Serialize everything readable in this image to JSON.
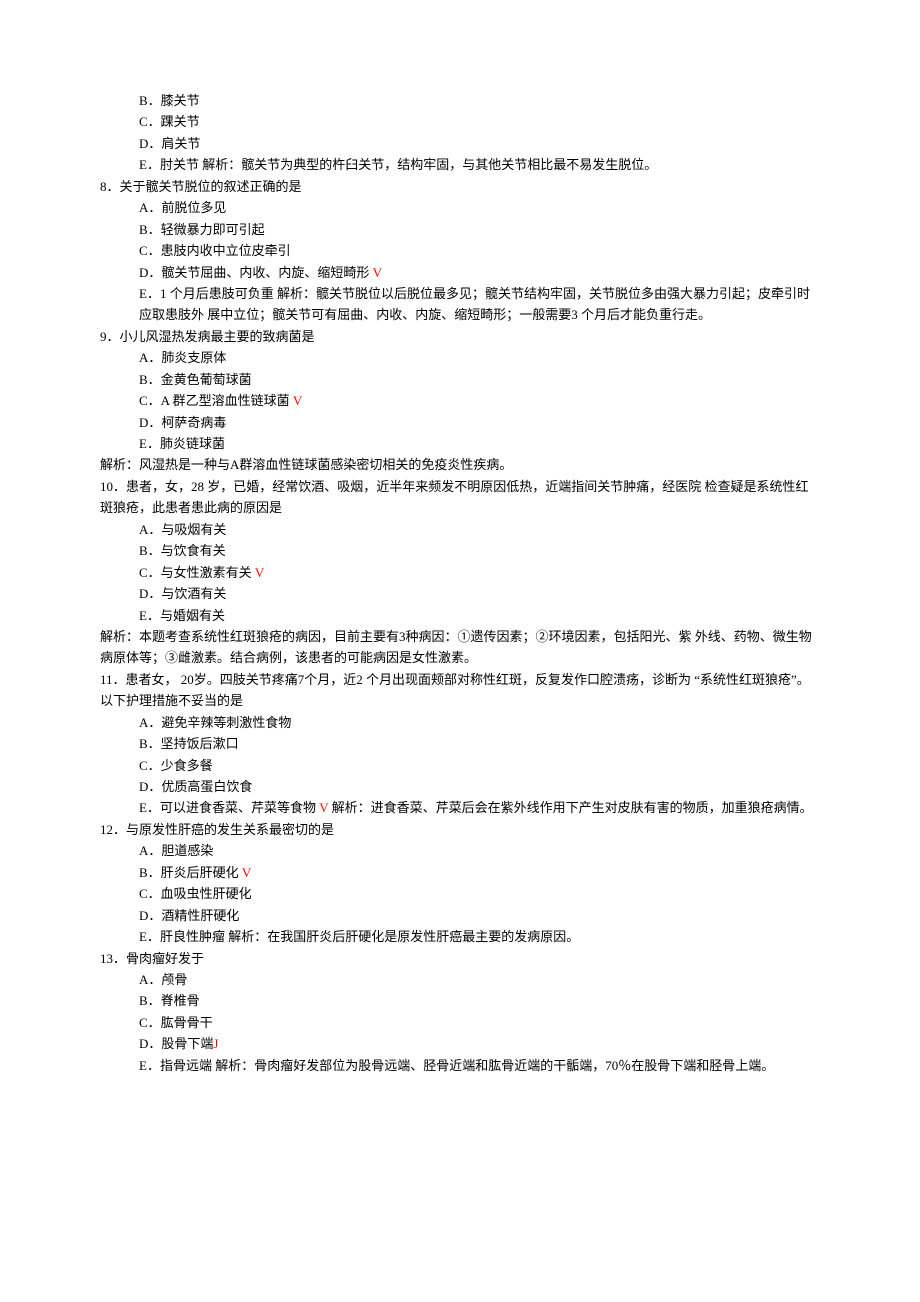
{
  "q7": {
    "optB": "B．膝关节",
    "optC": "C．踝关节",
    "optD": "D．肩关节",
    "optE_pre": "E．肘关节 解析：髋关节为典型的杵臼关节，结构牢固，与其他关节相比最不易发生脱位。"
  },
  "q8": {
    "stem": "8．关于髋关节脱位的叙述正确的是",
    "optA": "A．前脱位多见",
    "optB": "B．轻微暴力即可引起",
    "optC": "C．患肢内收中立位皮牵引",
    "optD_pre": "D．髋关节屈曲、内收、内旋、缩短畸形 ",
    "optD_mark": "V",
    "optE": "E．1 个月后患肢可负重 解析：髋关节脱位以后脱位最多见；髋关节结构牢固，关节脱位多由强大暴力引起；皮牵引时应取患肢外 展中立位；髋关节可有屈曲、内收、内旋、缩短畸形；一般需要3 个月后才能负重行走。"
  },
  "q9": {
    "stem": "9．小儿风湿热发病最主要的致病菌是",
    "optA": "A．肺炎支原体",
    "optB": "B．金黄色葡萄球菌",
    "optC_pre": "C．A 群乙型溶血性链球菌 ",
    "optC_mark": "V",
    "optD": "D．柯萨奇病毒",
    "optE": "E．肺炎链球菌",
    "explain": "解析：风湿热是一种与A群溶血性链球菌感染密切相关的免疫炎性疾病。"
  },
  "q10": {
    "stem": "10．患者，女，28 岁，已婚，经常饮酒、吸烟，近半年来频发不明原因低热，近端指间关节肿痛，经医院 检查疑是系统性红斑狼疮，此患者患此病的原因是",
    "optA": "A．与吸烟有关",
    "optB": "B．与饮食有关",
    "optC_pre": "C．与女性激素有关 ",
    "optC_mark": "V",
    "optD": "D．与饮酒有关",
    "optE": "E．与婚姻有关",
    "explain": "解析：本题考查系统性红斑狼疮的病因，目前主要有3种病因：①遗传因素；②环境因素，包括阳光、紫  外线、药物、微生物病原体等；③雌激素。结合病例，该患者的可能病因是女性激素。"
  },
  "q11": {
    "stem": "11．患者女， 20岁。四肢关节疼痛7个月，近2 个月出现面颊部对称性红斑，反复发作口腔溃疡，诊断为 “系统性红斑狼疮”。以下护理措施不妥当的是",
    "optA": "A．避免辛辣等刺激性食物",
    "optB": "B．坚持饭后漱口",
    "optC": "C．少食多餐",
    "optD": "D．优质高蛋白饮食",
    "optE_pre": "E．可以进食香菜、芹菜等食物 ",
    "optE_mark": "V",
    "optE_post": " 解析：进食香菜、芹菜后会在紫外线作用下产生对皮肤有害的物质，加重狼疮病情。"
  },
  "q12": {
    "stem": "12．与原发性肝癌的发生关系最密切的是",
    "optA": "A．胆道感染",
    "optB_pre": "B．肝炎后肝硬化 ",
    "optB_mark": "V",
    "optC": "C．血吸虫性肝硬化",
    "optD": "D．酒精性肝硬化",
    "optE": "E．肝良性肿瘤 解析：在我国肝炎后肝硬化是原发性肝癌最主要的发病原因。"
  },
  "q13": {
    "stem": "13．骨肉瘤好发于",
    "optA": "A．颅骨",
    "optB": "B．脊椎骨",
    "optC": "C．肱骨骨干",
    "optD_pre": "D．股骨下端",
    "optD_mark": "J",
    "optE": "E．指骨远端  解析：骨肉瘤好发部位为股骨远端、胫骨近端和肱骨近端的干骺端，70％在股骨下端和胫骨上端。"
  }
}
